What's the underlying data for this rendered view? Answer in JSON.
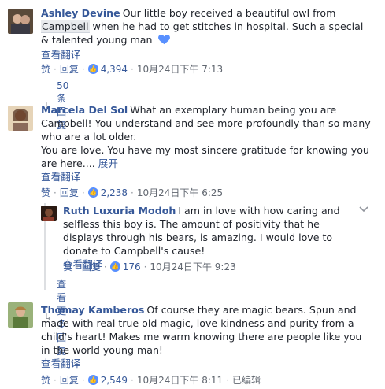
{
  "comments": [
    {
      "name": "Ashley Devine",
      "text_before": "Our little boy received a beautiful owl from ",
      "mention": "Campbell",
      "text_after": " when he had to get stitches in hospital. Such a special & talented young man",
      "translate": "查看翻译",
      "like": "赞",
      "reply": "回复",
      "reactions": "4,394",
      "time": "10月24日下午 7:13",
      "replies_link": "50条回复"
    },
    {
      "name": "Marcela Del Sol",
      "text_line1": "What an exemplary human being you are Campbell! You understand and see more profoundly than so many who are a lot older.",
      "text_line2": "You are love. You have my most sincere gratitude for knowing you are here....",
      "expand": "展开",
      "translate": "查看翻译",
      "like": "赞",
      "reply": "回复",
      "reactions": "2,238",
      "time": "10月24日下午 6:25"
    },
    {
      "name": "Ruth Luxuria Modoh",
      "text": "I am in love with how caring and selfless this boy is. The amount of positivity that he displays through his bears, is amazing. I would love to donate to Campbell's cause!",
      "translate": "查看翻译",
      "like": "赞",
      "reply": "回复",
      "reactions": "176",
      "time": "10月24日下午 9:23",
      "more_replies": "查看更多回复"
    },
    {
      "name": "Thomay Kamberos",
      "text": "Of course they are magic bears. Spun and made with real true old magic, love kindness and purity from a child's heart! Makes me warm knowing there are people like you in the world young man!",
      "translate": "查看翻译",
      "like": "赞",
      "reply": "回复",
      "reactions": "2,549",
      "time": "10月24日下午 8:11",
      "edited": "已编辑"
    }
  ],
  "colors": {
    "link": "#365899",
    "meta": "#616770",
    "like_badge": "#5890ff",
    "heart": "#5890ff"
  },
  "icons": {
    "heart": "blue-heart-emoji",
    "like": "thumbs-up-icon",
    "reply_arrow": "reply-arrow-icon",
    "menu": "chevron-down-icon"
  }
}
